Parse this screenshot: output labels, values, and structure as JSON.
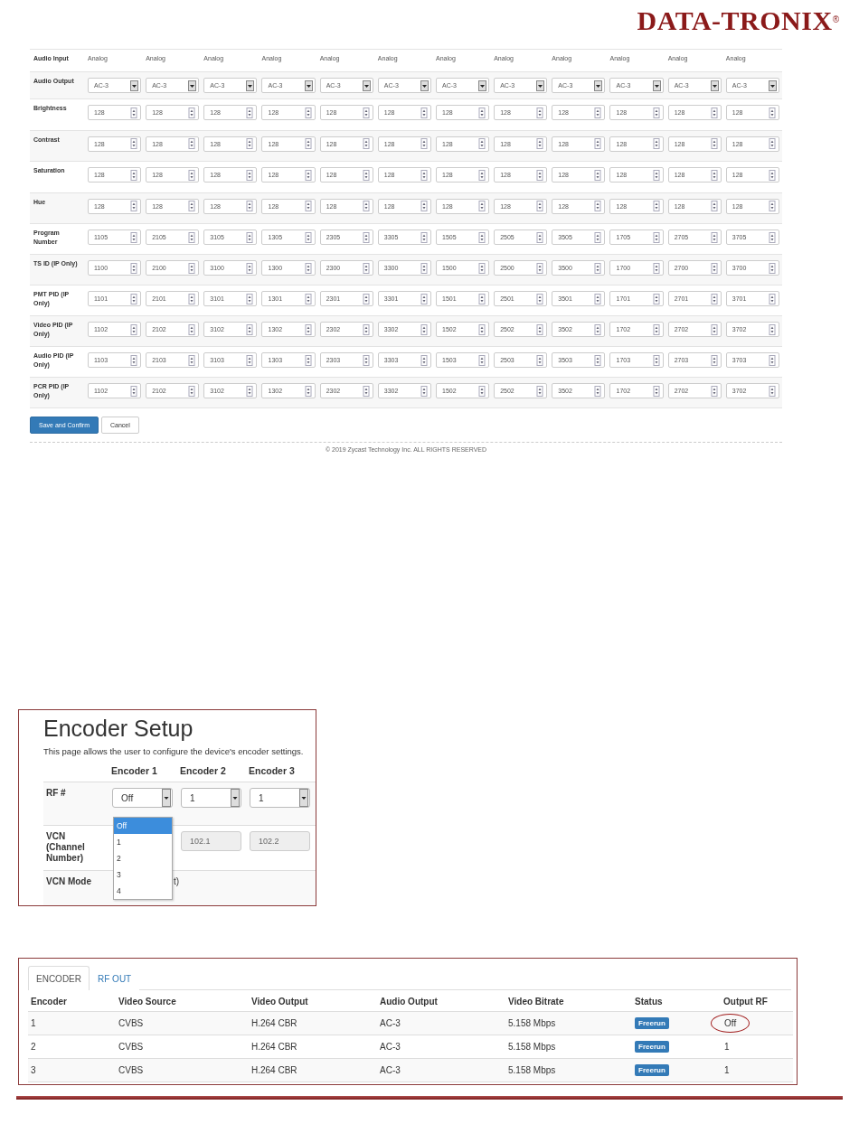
{
  "logo": {
    "name": "DATA-TRONIX",
    "mark": "®"
  },
  "settings_table": {
    "rows": [
      {
        "label": "Audio Input",
        "kind": "text",
        "values": [
          "Analog",
          "Analog",
          "Analog",
          "Analog",
          "Analog",
          "Analog",
          "Analog",
          "Analog",
          "Analog",
          "Analog",
          "Analog",
          "Analog"
        ]
      },
      {
        "label": "Audio Output",
        "kind": "select",
        "values": [
          "AC-3",
          "AC-3",
          "AC-3",
          "AC-3",
          "AC-3",
          "AC-3",
          "AC-3",
          "AC-3",
          "AC-3",
          "AC-3",
          "AC-3",
          "AC-3"
        ]
      },
      {
        "label": "Brightness",
        "kind": "spin",
        "values": [
          "128",
          "128",
          "128",
          "128",
          "128",
          "128",
          "128",
          "128",
          "128",
          "128",
          "128",
          "128"
        ]
      },
      {
        "label": "Contrast",
        "kind": "spin",
        "values": [
          "128",
          "128",
          "128",
          "128",
          "128",
          "128",
          "128",
          "128",
          "128",
          "128",
          "128",
          "128"
        ]
      },
      {
        "label": "Saturation",
        "kind": "spin",
        "values": [
          "128",
          "128",
          "128",
          "128",
          "128",
          "128",
          "128",
          "128",
          "128",
          "128",
          "128",
          "128"
        ]
      },
      {
        "label": "Hue",
        "kind": "spin",
        "values": [
          "128",
          "128",
          "128",
          "128",
          "128",
          "128",
          "128",
          "128",
          "128",
          "128",
          "128",
          "128"
        ]
      },
      {
        "label": "Program Number",
        "kind": "spin",
        "values": [
          "1105",
          "2105",
          "3105",
          "1305",
          "2305",
          "3305",
          "1505",
          "2505",
          "3505",
          "1705",
          "2705",
          "3705"
        ]
      },
      {
        "label": "TS ID (IP Only)",
        "kind": "spin",
        "values": [
          "1100",
          "2100",
          "3100",
          "1300",
          "2300",
          "3300",
          "1500",
          "2500",
          "3500",
          "1700",
          "2700",
          "3700"
        ]
      },
      {
        "label": "PMT PID (IP Only)",
        "kind": "spin",
        "values": [
          "1101",
          "2101",
          "3101",
          "1301",
          "2301",
          "3301",
          "1501",
          "2501",
          "3501",
          "1701",
          "2701",
          "3701"
        ]
      },
      {
        "label": "Video PID (IP Only)",
        "kind": "spin",
        "values": [
          "1102",
          "2102",
          "3102",
          "1302",
          "2302",
          "3302",
          "1502",
          "2502",
          "3502",
          "1702",
          "2702",
          "3702"
        ]
      },
      {
        "label": "Audio PID (IP Only)",
        "kind": "spin",
        "values": [
          "1103",
          "2103",
          "3103",
          "1303",
          "2303",
          "3303",
          "1503",
          "2503",
          "3503",
          "1703",
          "2703",
          "3703"
        ]
      },
      {
        "label": "PCR PID (IP Only)",
        "kind": "spin",
        "values": [
          "1102",
          "2102",
          "3102",
          "1302",
          "2302",
          "3302",
          "1502",
          "2502",
          "3502",
          "1702",
          "2702",
          "3702"
        ]
      }
    ],
    "buttons": [
      {
        "label": "Save and Confirm",
        "kind": "primary"
      },
      {
        "label": "Cancel",
        "kind": "default"
      }
    ],
    "footer": "© 2019 Zycast Technology Inc. ALL RIGHTS RESERVED"
  },
  "encoder_setup": {
    "title": "Encoder Setup",
    "description": "This page allows the user to configure the device's encoder settings.",
    "columns": [
      "Encoder 1",
      "Encoder 2",
      "Encoder 3"
    ],
    "rf_label": "RF #",
    "rf_values": [
      "Off",
      "1",
      "1"
    ],
    "dropdown_options": [
      {
        "label": "Off",
        "selected": true
      },
      {
        "label": "1",
        "selected": false
      },
      {
        "label": "2",
        "selected": false
      },
      {
        "label": "3",
        "selected": false
      },
      {
        "label": "4",
        "selected": false
      }
    ],
    "vcn_label": "VCN (Channel Number)",
    "vcn_values": [
      "102.1",
      "102.2"
    ],
    "vcn_mode_label": "VCN Mode",
    "vcn_mode_value": "t)"
  },
  "encoder_status": {
    "tabs": [
      {
        "label": "ENCODER",
        "selected": true
      },
      {
        "label": "RF OUT",
        "selected": false
      }
    ],
    "columns": [
      "Encoder",
      "Video Source",
      "Video Output",
      "Audio Output",
      "Video Bitrate",
      "Status",
      "Output RF"
    ],
    "rows": [
      {
        "cells": [
          "1",
          "CVBS",
          "H.264 CBR",
          "AC-3",
          "5.158 Mbps"
        ],
        "status": "Freerun",
        "output_rf": "Off",
        "circled": true
      },
      {
        "cells": [
          "2",
          "CVBS",
          "H.264 CBR",
          "AC-3",
          "5.158 Mbps"
        ],
        "status": "Freerun",
        "output_rf": "1",
        "circled": false
      },
      {
        "cells": [
          "3",
          "CVBS",
          "H.264 CBR",
          "AC-3",
          "5.158 Mbps"
        ],
        "status": "Freerun",
        "output_rf": "1",
        "circled": false
      }
    ]
  }
}
